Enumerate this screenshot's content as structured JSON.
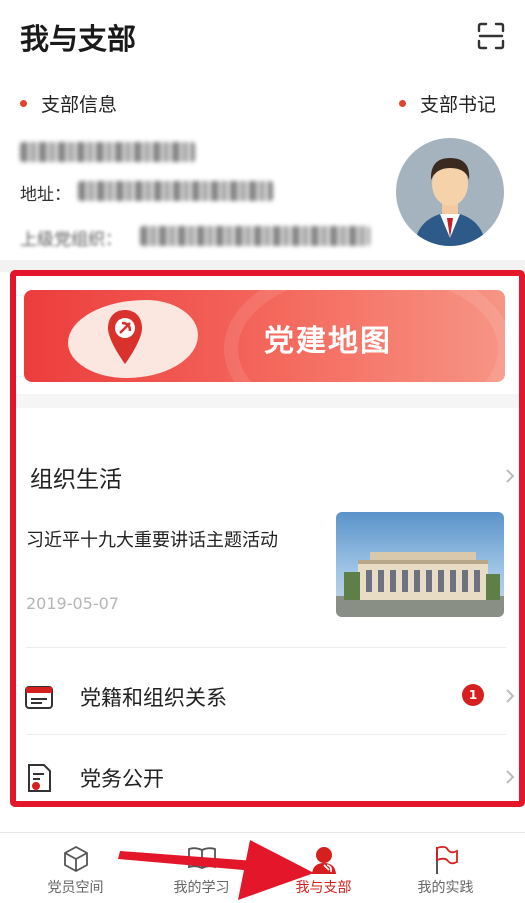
{
  "header": {
    "title": "我与支部",
    "scan_icon": "scan-icon"
  },
  "branch": {
    "info_label": "支部信息",
    "secretary_label": "支部书记",
    "accent": "#e0442a",
    "address_prefix": "地址：",
    "parent_org_prefix": "上级党组织："
  },
  "card": {
    "border_color": "#e3162a",
    "banner": {
      "title": "党建地图"
    },
    "section": {
      "title": "组织生活"
    },
    "news": {
      "title": "习近平十九大重要讲话主题活动",
      "date": "2019-05-07"
    },
    "menu": [
      {
        "label": "党籍和组织关系",
        "badge": "1"
      },
      {
        "label": "党务公开"
      }
    ]
  },
  "tabs": [
    {
      "label": "党员空间",
      "icon": "cube-icon",
      "active": false
    },
    {
      "label": "我的学习",
      "icon": "book-icon",
      "active": false
    },
    {
      "label": "我与支部",
      "icon": "party-member-icon",
      "active": true
    },
    {
      "label": "我的实践",
      "icon": "flag-icon",
      "active": false
    }
  ],
  "colors": {
    "active": "#d6201f",
    "annotation_arrow": "#e3162a"
  }
}
